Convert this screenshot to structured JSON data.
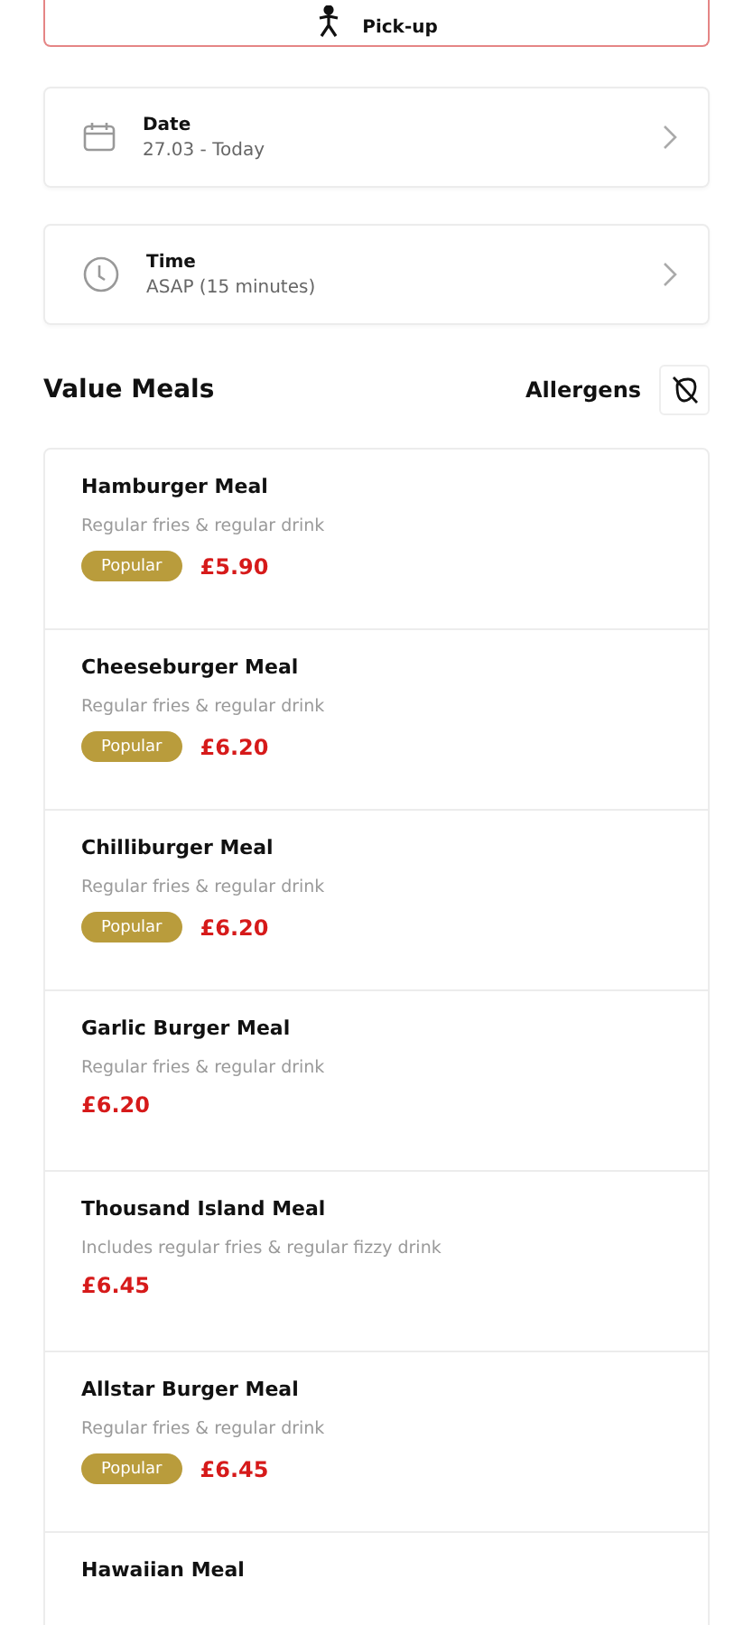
{
  "order_type": {
    "label": "Pick-up"
  },
  "options": [
    {
      "kind": "date",
      "title": "Date",
      "value": "27.03 - Today"
    },
    {
      "kind": "time",
      "title": "Time",
      "value": "ASAP (15 minutes)"
    }
  ],
  "section": {
    "title": "Value Meals",
    "allergens_label": "Allergens"
  },
  "meals": [
    {
      "name": "Hamburger Meal",
      "description": "Regular fries & regular drink",
      "badge": "Popular",
      "price": "£5.90"
    },
    {
      "name": "Cheeseburger Meal",
      "description": "Regular fries & regular drink",
      "badge": "Popular",
      "price": "£6.20"
    },
    {
      "name": "Chilliburger Meal",
      "description": "Regular fries & regular drink",
      "badge": "Popular",
      "price": "£6.20"
    },
    {
      "name": "Garlic Burger Meal",
      "description": "Regular fries & regular drink",
      "price": "£6.20"
    },
    {
      "name": "Thousand Island Meal",
      "description": "Includes regular fries & regular fizzy drink",
      "price": "£6.45"
    },
    {
      "name": "Allstar Burger Meal",
      "description": "Regular fries & regular drink",
      "badge": "Popular",
      "price": "£6.45"
    },
    {
      "name": "Hawaiian Meal"
    }
  ]
}
